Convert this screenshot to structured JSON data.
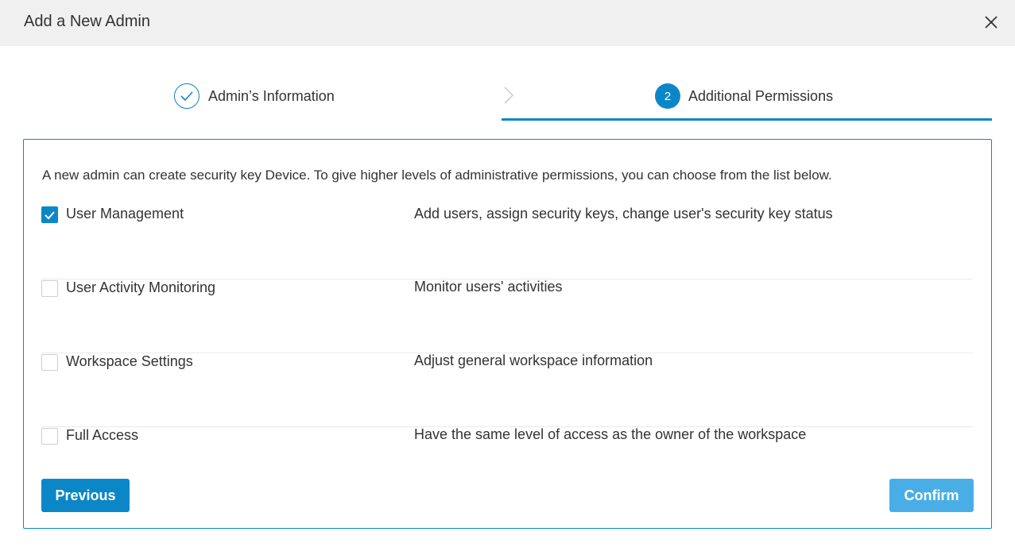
{
  "dialog": {
    "title": "Add a New Admin"
  },
  "stepper": {
    "steps": [
      {
        "label": "Admin’s Information",
        "status": "completed"
      },
      {
        "number": "2",
        "label": "Additional Permissions",
        "status": "active"
      }
    ]
  },
  "permissions": {
    "intro": "A new admin can create security key Device. To give higher levels of administrative permissions, you can choose from the list below.",
    "items": [
      {
        "name": "User Management",
        "description": "Add users, assign security keys, change user's security key status",
        "checked": true
      },
      {
        "name": "User Activity Monitoring",
        "description": "Monitor users' activities",
        "checked": false
      },
      {
        "name": "Workspace Settings",
        "description": "Adjust general workspace information",
        "checked": false
      },
      {
        "name": "Full Access",
        "description": "Have the same level of access as the owner of the workspace",
        "checked": false
      }
    ]
  },
  "actions": {
    "previous_label": "Previous",
    "confirm_label": "Confirm"
  },
  "colors": {
    "accent": "#0b87c8",
    "confirm_disabled": "#4aaee6",
    "header_bg": "#f0f0f0"
  }
}
